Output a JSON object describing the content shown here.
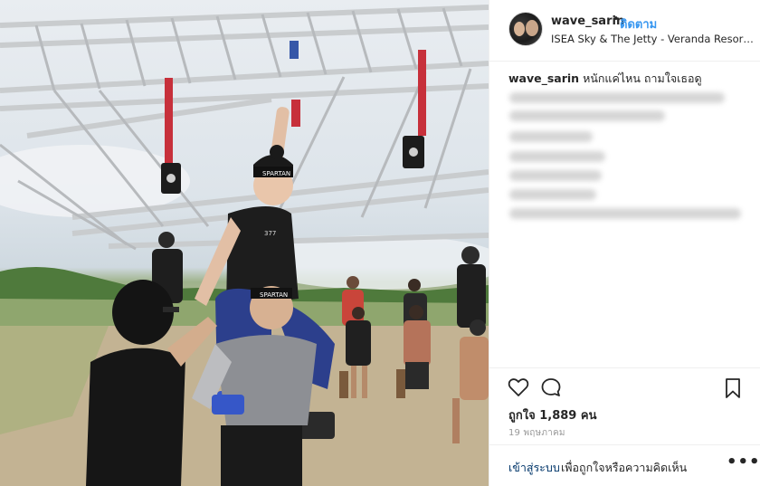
{
  "post": {
    "username": "wave_sarin",
    "separator": "•",
    "follow_label": "ติดตาม",
    "location": "ISEA Sky & The Jetty - Veranda Resort Patt...",
    "caption_username": "wave_sarin",
    "caption_text": "หนักแค่ไหน ถามใจเธอดู",
    "likes": "ถูกใจ 1,889 คน",
    "date": "19 พฤษภาคม"
  },
  "footer": {
    "login_link": "เข้าสู่ระบบ",
    "login_prompt": "เพื่อถูกใจหรือความคิดเห็น",
    "more_label": "•••"
  },
  "photo": {
    "headband_text_1": "SPARTAN",
    "headband_text_2": "SPARTAN",
    "shirt_number": "377"
  },
  "icons": {
    "like": "heart-icon",
    "comment": "comment-icon",
    "save": "bookmark-icon",
    "options": "more-options-icon"
  },
  "colors": {
    "link_blue": "#3897f0",
    "login_blue": "#003569",
    "text": "#262626",
    "muted": "#999999",
    "border": "#efefef"
  }
}
